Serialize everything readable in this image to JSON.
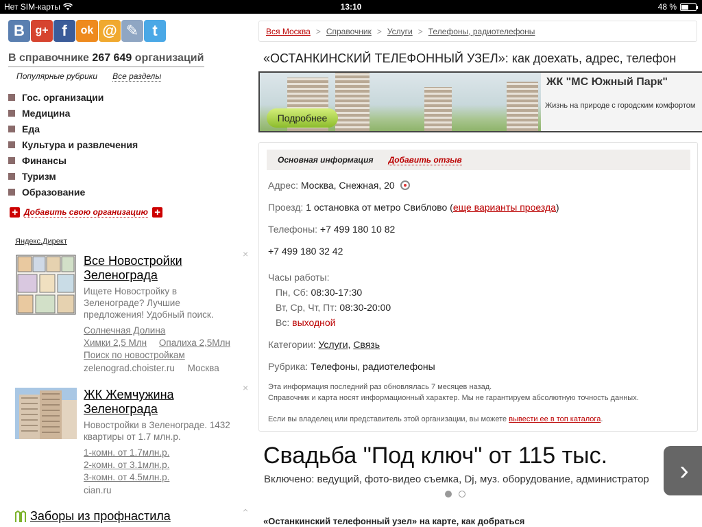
{
  "status": {
    "carrier": "Нет SIM-карты",
    "time": "13:10",
    "battery": "48 %",
    "battery_level": 0.48
  },
  "social": [
    {
      "name": "vkontakte",
      "glyph": "В",
      "color": "#5a7fb0"
    },
    {
      "name": "googleplus",
      "glyph": "g+",
      "color": "#d6442f"
    },
    {
      "name": "facebook",
      "glyph": "f",
      "color": "#3b5c99"
    },
    {
      "name": "odnoklassniki",
      "glyph": "ok",
      "color": "#ee8a1e"
    },
    {
      "name": "mailru",
      "glyph": "@",
      "color": "#f0a92f"
    },
    {
      "name": "livejournal",
      "glyph": "✎",
      "color": "#8fa6c3"
    },
    {
      "name": "twitter",
      "glyph": "t",
      "color": "#4aa8e6"
    }
  ],
  "directory": {
    "count_prefix": "В справочнике",
    "count": "267 649",
    "count_suffix": "организаций",
    "tab_popular": "Популярные рубрики",
    "tab_all": "Все разделы",
    "categories": [
      "Гос. организации",
      "Медицина",
      "Еда",
      "Культура и развлечения",
      "Финансы",
      "Туризм",
      "Образование"
    ],
    "add_org": "Добавить свою организацию"
  },
  "ads": {
    "label": "Яндекс.Директ",
    "items": [
      {
        "title": "Все Новостройки Зеленограда",
        "text": "Ищете Новостройку в Зеленограде? Лучшие предложения! Удобный поиск.",
        "links": [
          "Солнечная Долина",
          "Химки 2,5 Млн",
          "Опалиха 2,5Млн",
          "Поиск по новостройкам"
        ],
        "domain": "zelenograd.choister.ru",
        "region": "Москва"
      },
      {
        "title": "ЖК Жемчужина Зеленограда",
        "text": "Новостройки в Зеленограде. 1432 квартиры от 1.7 млн.р.",
        "links": [
          "1-комн. от 1.7млн.р.",
          "2-комн. от 3.1млн.р.",
          "3-комн. от 4.5млн.р."
        ],
        "domain": "cian.ru"
      },
      {
        "title": "Заборы из профнастила"
      }
    ],
    "close": "×"
  },
  "breadcrumb": [
    "Вся Москва",
    "Справочник",
    "Услуги",
    "Телефоны, радиотелефоны"
  ],
  "page_title": "«ОСТАНКИНСКИЙ ТЕЛЕФОННЫЙ УЗЕЛ»: как доехать, адрес, телефон",
  "banner": {
    "button": "Подробнее",
    "title": "ЖК \"МС Южный Парк\"",
    "subtitle": "Жизнь на природе с городским комфортом"
  },
  "info": {
    "tab_main": "Основная информация",
    "tab_review": "Добавить отзыв",
    "address_label": "Адрес:",
    "address": "Москва, Снежная, 20",
    "route_label": "Проезд:",
    "route": "1 остановка от метро Свиблово (",
    "route_link": "еще варианты проезда",
    "route_end": ")",
    "phones_label": "Телефоны:",
    "phone1": "+7 499 180 10 82",
    "phone2": "+7 499 180 32 42",
    "hours_label": "Часы работы:",
    "hours": [
      {
        "days": "Пн, Сб:",
        "time": "08:30-17:30"
      },
      {
        "days": "Вт, Ср, Чт, Пт:",
        "time": "08:30-20:00"
      },
      {
        "days": "Вс:",
        "time": "выходной"
      }
    ],
    "categories_label": "Категории:",
    "cat1": "Услуги",
    "cat2": "Связь",
    "rubric_label": "Рубрика:",
    "rubric": "Телефоны, радиотелефоны",
    "updated": "Эта информация последний раз обновлялась 7 месяцев назад.",
    "disclaimer": "Справочник и карта носят информационный характер. Мы не гарантируем абсолютную точность данных.",
    "owner_text": "Если вы владелец или представитель этой организации, вы можете",
    "owner_link": "вывести ее в топ каталога",
    "owner_end": "."
  },
  "promo": {
    "title": "Свадьба \"Под ключ\" от 115 тыс.",
    "text": "Включено: ведущий, фото-видео съемка, Dj, муз. оборудование, администратор",
    "next": "›"
  },
  "map_title": "«Останкинский телефонный узел» на карте, как добраться"
}
